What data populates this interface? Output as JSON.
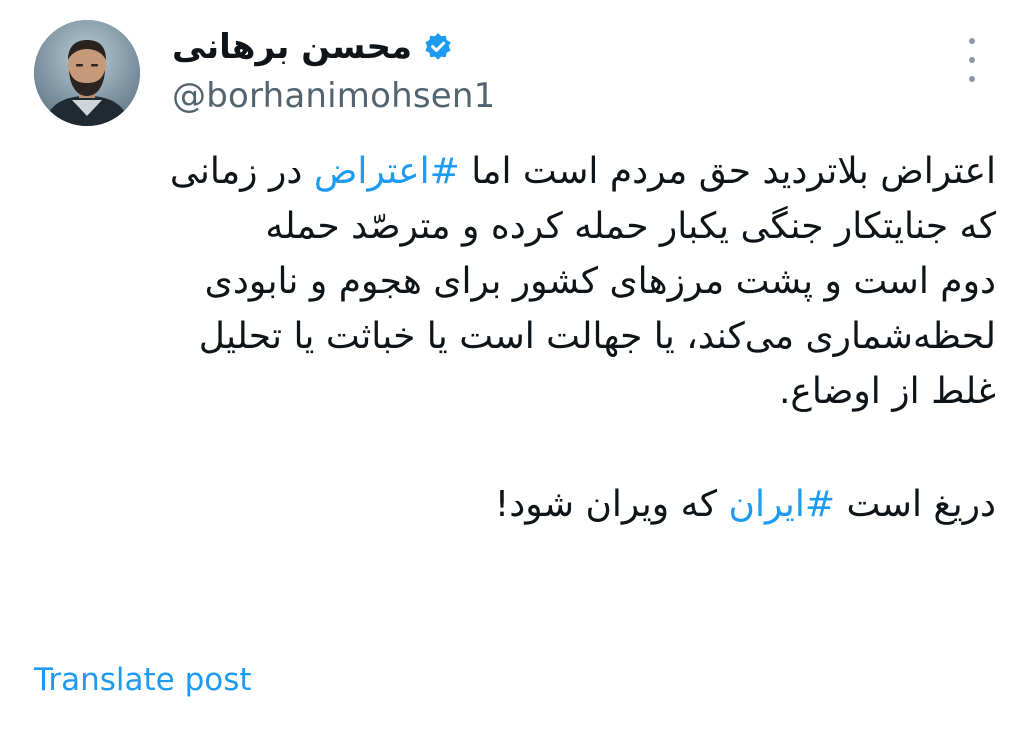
{
  "author": {
    "display_name": "محسن برهانی",
    "handle": "@borhanimohsen1",
    "verified": true,
    "avatar_icon": "profile-photo"
  },
  "menu": {
    "icon": "more-vertical-icon"
  },
  "tweet": {
    "lines": [
      {
        "before": "اعتراض بلاتردید حق مردم است اما ",
        "hashtag": "#اعتراض",
        "after": " در زمانی"
      },
      {
        "text": "که جنایتکار جنگی یکبار حمله کرده و مترصّد حمله"
      },
      {
        "text": "دوم است و پشت مرزهای کشور برای هجوم و نابودی"
      },
      {
        "text": "لحظه‌شماری می‌کند، یا جهالت است یا خباثت یا تحلیل"
      },
      {
        "text": "غلط از اوضاع."
      }
    ],
    "last_line": {
      "before": "دریغ است ",
      "hashtag": "#ایران",
      "after": " که ویران شود!"
    }
  },
  "translate_label": "Translate post",
  "colors": {
    "accent": "#1d9bf0",
    "text": "#0f1419",
    "secondary": "#536471"
  }
}
